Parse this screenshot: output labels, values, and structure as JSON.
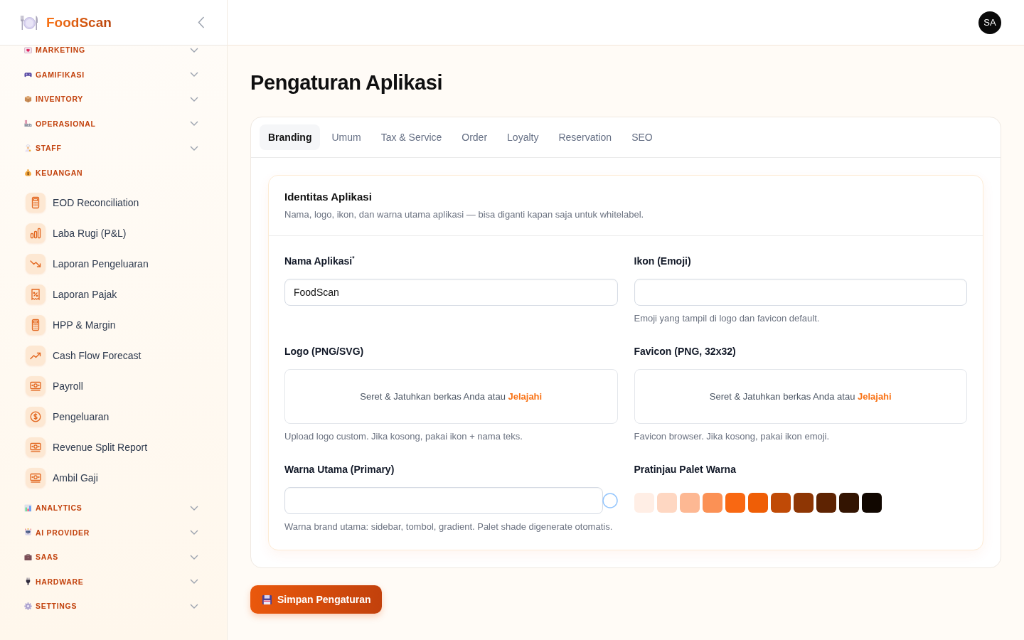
{
  "sidebar": {
    "brand": "FoodScan",
    "groups": [
      {
        "label": "MARKETING",
        "expanded": false
      },
      {
        "label": "GAMIFIKASI",
        "expanded": false
      },
      {
        "label": "INVENTORY",
        "expanded": false
      },
      {
        "label": "OPERASIONAL",
        "expanded": false
      },
      {
        "label": "STAFF",
        "expanded": false
      },
      {
        "label": "KEUANGAN",
        "expanded": true,
        "children": [
          {
            "label": "EOD Reconciliation",
            "selected": false
          },
          {
            "label": "Laba Rugi (P&L)",
            "selected": false
          },
          {
            "label": "Laporan Pengeluaran",
            "selected": false
          },
          {
            "label": "Laporan Pajak",
            "selected": false
          },
          {
            "label": "HPP & Margin",
            "selected": false
          },
          {
            "label": "Cash Flow Forecast",
            "selected": false
          },
          {
            "label": "Payroll",
            "selected": false
          },
          {
            "label": "Pengeluaran",
            "selected": false
          },
          {
            "label": "Revenue Split Report",
            "selected": false
          },
          {
            "label": "Ambil Gaji",
            "selected": false
          }
        ]
      },
      {
        "label": "ANALYTICS",
        "expanded": false
      },
      {
        "label": "AI PROVIDER",
        "expanded": false
      },
      {
        "label": "SAAS",
        "expanded": false
      },
      {
        "label": "HARDWARE",
        "expanded": false
      },
      {
        "label": "SETTINGS",
        "expanded": false
      }
    ]
  },
  "header": {
    "avatar": "SA"
  },
  "page": {
    "title": "Pengaturan Aplikasi"
  },
  "tabs": [
    {
      "label": "Branding",
      "selected": true
    },
    {
      "label": "Umum",
      "selected": false
    },
    {
      "label": "Tax & Service",
      "selected": false
    },
    {
      "label": "Order",
      "selected": false
    },
    {
      "label": "Loyalty",
      "selected": false
    },
    {
      "label": "Reservation",
      "selected": false
    },
    {
      "label": "SEO",
      "selected": false
    }
  ],
  "section": {
    "title": "Identitas Aplikasi",
    "description": "Nama, logo, ikon, dan warna utama aplikasi — bisa diganti kapan saja untuk whitelabel."
  },
  "fields": [
    {
      "kind": "text",
      "label": "Nama Aplikasi$^{*}$",
      "value": "FoodScan"
    },
    {
      "kind": "text",
      "label": "Ikon (Emoji)",
      "help": "Emoji yang tampil di logo dan favicon default."
    },
    {
      "kind": "upload",
      "label": "Logo (PNG/SVG)",
      "prompt": "Seret & Jatuhkan berkas Anda atau",
      "link": "Jelajahi",
      "help": "Upload logo custom. Jika kosong, pakai ikon + nama teks."
    },
    {
      "kind": "upload",
      "label": "Favicon (PNG, 32x32)",
      "prompt": "Seret & Jatuhkan berkas Anda atau",
      "link": "Jelajahi",
      "help": "Favicon browser. Jika kosong, pakai ikon emoji."
    },
    {
      "kind": "color",
      "label": "Warna Utama (Primary)",
      "help": "Warna brand utama: sidebar, tombol, gradient. Palet shade digenerate otomatis."
    },
    {
      "kind": "palette",
      "label": "Pratinjau Palet Warna",
      "swatches": [
        {
          "color": "#ffeee5"
        },
        {
          "color": "#fed7c2"
        },
        {
          "color": "#fdb893"
        },
        {
          "color": "#fb9155"
        },
        {
          "color": "#f96812"
        },
        {
          "color": "#ef5e06"
        },
        {
          "color": "#c04a06"
        },
        {
          "color": "#8e3604"
        },
        {
          "color": "#5e2302"
        },
        {
          "color": "#331401"
        },
        {
          "color": "#110700"
        }
      ]
    }
  ],
  "save_button": "Simpan Pengaturan"
}
